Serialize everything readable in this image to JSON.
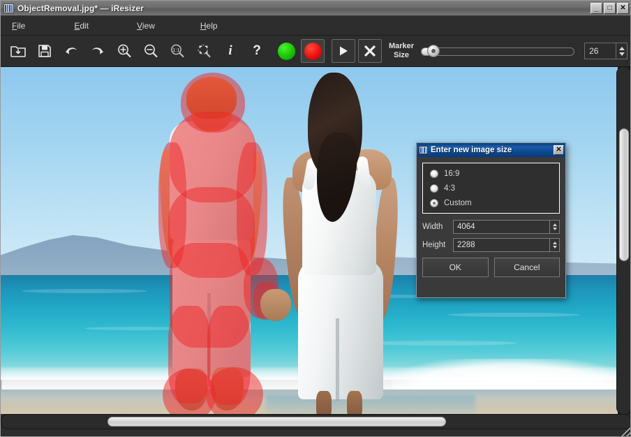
{
  "window": {
    "title": "ObjectRemoval.jpg* — iResizer",
    "icon": "image-stripes-icon",
    "controls": {
      "minimize": "_",
      "maximize": "□",
      "close": "✕"
    }
  },
  "menu": {
    "items": [
      {
        "mnemonic": "F",
        "rest": "ile",
        "label": "File"
      },
      {
        "mnemonic": "E",
        "rest": "dit",
        "label": "Edit"
      },
      {
        "mnemonic": "V",
        "rest": "iew",
        "label": "View"
      },
      {
        "mnemonic": "H",
        "rest": "elp",
        "label": "Help"
      }
    ]
  },
  "toolbar": {
    "buttons": [
      {
        "name": "open-icon",
        "tooltip": "Open"
      },
      {
        "name": "save-icon",
        "tooltip": "Save"
      },
      {
        "name": "undo-icon",
        "tooltip": "Undo"
      },
      {
        "name": "redo-icon",
        "tooltip": "Redo"
      },
      {
        "name": "zoom-in-icon",
        "tooltip": "Zoom In"
      },
      {
        "name": "zoom-out-icon",
        "tooltip": "Zoom Out"
      },
      {
        "name": "zoom-actual-icon",
        "tooltip": "Zoom 1:1"
      },
      {
        "name": "zoom-fit-icon",
        "tooltip": "Fit to Window"
      },
      {
        "name": "info-icon",
        "tooltip": "Info"
      },
      {
        "name": "help-icon",
        "tooltip": "Help"
      },
      {
        "name": "green-marker-icon",
        "tooltip": "Protect Marker"
      },
      {
        "name": "red-marker-icon",
        "tooltip": "Remove Marker"
      },
      {
        "name": "play-icon",
        "tooltip": "Run"
      },
      {
        "name": "clear-icon",
        "tooltip": "Clear Markers"
      }
    ],
    "info_glyph": "i",
    "help_glyph": "?",
    "marker_size": {
      "label_line1": "Marker",
      "label_line2": "Size",
      "value": "26",
      "slider_percent": 5
    }
  },
  "dialog": {
    "title": "Enter new image size",
    "icon": "image-stripes-icon",
    "close_glyph": "✕",
    "aspect_options": [
      {
        "label": "16:9",
        "selected": false
      },
      {
        "label": "4:3",
        "selected": false
      },
      {
        "label": "Custom",
        "selected": true
      }
    ],
    "fields": [
      {
        "label": "Width",
        "value": "4064"
      },
      {
        "label": "Height",
        "value": "2288"
      }
    ],
    "buttons": {
      "ok": "OK",
      "cancel": "Cancel"
    }
  },
  "colors": {
    "title_bar": "#6e6e6e",
    "toolbar_bg": "#2d2d2d",
    "dialog_title": "#0e4a93",
    "marker_green": "#18c400",
    "marker_red": "#ec0f0f",
    "mask_red": "rgba(237,38,38,0.50)"
  },
  "canvas": {
    "description": "Beach photo: man marked with red removal mask holding hands with woman in white",
    "vertical_scroll_percent": 18,
    "horizontal_scroll_percent": 18
  }
}
